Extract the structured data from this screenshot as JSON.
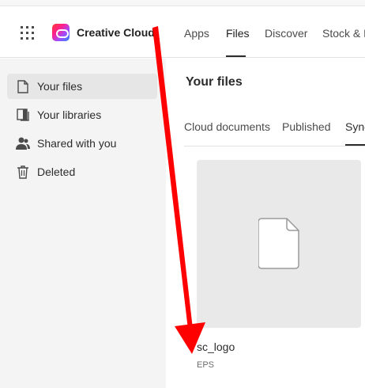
{
  "header": {
    "brand": "Creative Cloud",
    "nav": [
      {
        "label": "Apps"
      },
      {
        "label": "Files"
      },
      {
        "label": "Discover"
      },
      {
        "label": "Stock & M"
      }
    ]
  },
  "sidebar": {
    "items": [
      {
        "label": "Your files",
        "icon": "file-icon"
      },
      {
        "label": "Your libraries",
        "icon": "library-icon"
      },
      {
        "label": "Shared with you",
        "icon": "people-icon"
      },
      {
        "label": "Deleted",
        "icon": "trash-icon"
      }
    ]
  },
  "main": {
    "title": "Your files",
    "tabs": [
      {
        "label": "Cloud documents"
      },
      {
        "label": "Published"
      },
      {
        "label": "Sync"
      }
    ],
    "files": [
      {
        "name": "sc_logo",
        "type": "EPS"
      }
    ]
  },
  "colors": {
    "annotation_arrow": "#ff0000",
    "sidebar_bg": "#f4f4f4",
    "card_bg": "#e9e9e9"
  }
}
